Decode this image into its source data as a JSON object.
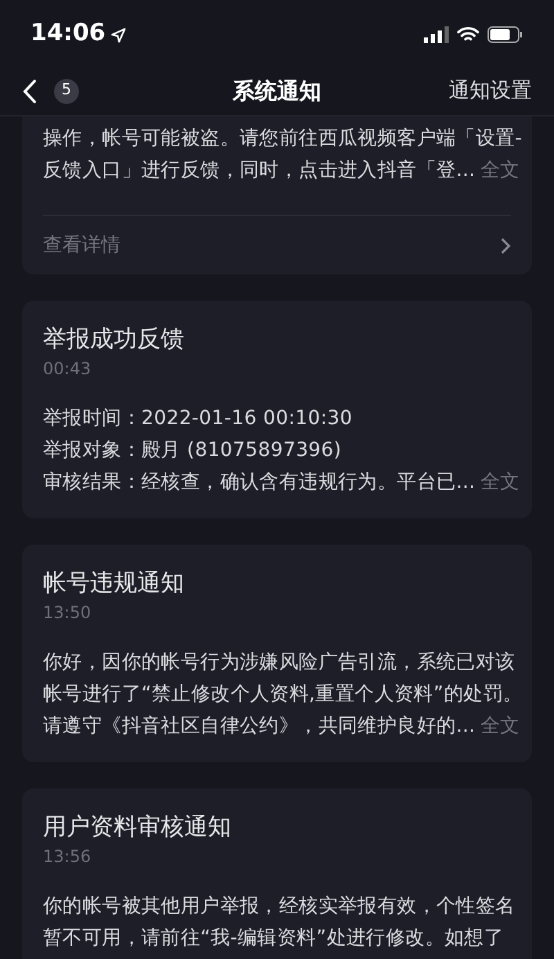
{
  "status_bar": {
    "time": "14:06"
  },
  "nav": {
    "badge": "5",
    "title": "系统通知",
    "action": "通知设置"
  },
  "cards": [
    {
      "lines": [
        "操作，帐号可能被盗。请您前往西瓜视频客户端「设置-",
        "反馈入口」进行反馈，同时，点击进入抖音「登..."
      ],
      "more": "全文",
      "link": "查看详情"
    },
    {
      "title": "举报成功反馈",
      "time": "00:43",
      "lines": [
        "举报时间：2022-01-16 00:10:30",
        "举报对象：殿月 (81075897396)",
        "审核结果：经核查，确认含有违规行为。平台已..."
      ],
      "more": "全文"
    },
    {
      "title": "帐号违规通知",
      "time": "13:50",
      "lines": [
        "你好，因你的帐号行为涉嫌风险广告引流，系统已对该",
        "帐号进行了“禁止修改个人资料,重置个人资料”的处罚。",
        "请遵守《抖音社区自律公约》，共同维护良好的..."
      ],
      "more": "全文"
    },
    {
      "title": "用户资料审核通知",
      "time": "13:56",
      "lines": [
        "你的帐号被其他用户举报，经核实举报有效，个性签名",
        "暂不可用，请前往“我-编辑资料”处进行修改。如想了"
      ]
    }
  ]
}
